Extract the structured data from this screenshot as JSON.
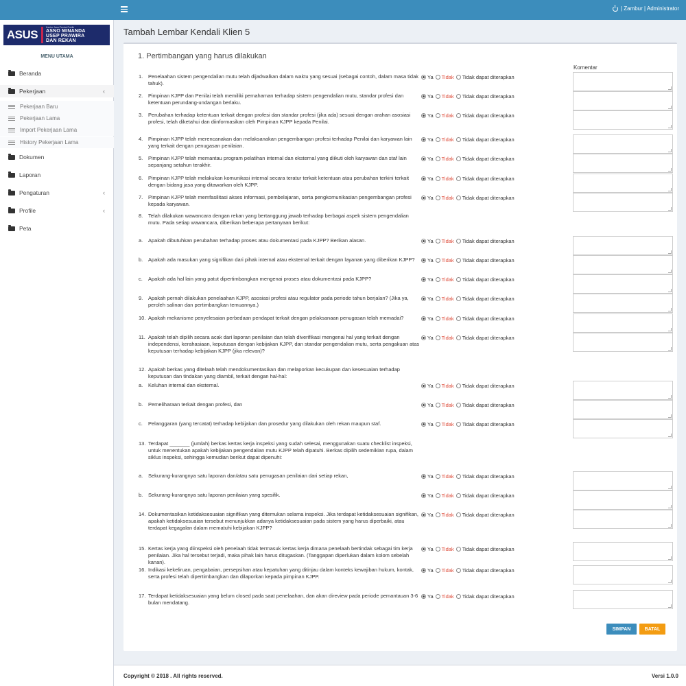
{
  "header": {
    "user_text": "| Zambur | Administrator"
  },
  "logo": {
    "brand": "ASUS",
    "small_text": "Kantor Jasa Pendai Publik",
    "name_line1": "ASNO MINANDA",
    "name_line2": "USEP PRAWIRA",
    "name_line3": "DAN REKAN"
  },
  "sidebar": {
    "header": "MENU UTAMA",
    "items": [
      {
        "label": "Beranda"
      },
      {
        "label": "Pekerjaan"
      },
      {
        "label": "Dokumen"
      },
      {
        "label": "Laporan"
      },
      {
        "label": "Pengaturan"
      },
      {
        "label": "Profile"
      },
      {
        "label": "Peta"
      }
    ],
    "subitems": [
      {
        "label": "Pekerjaan Baru"
      },
      {
        "label": "Pekerjaan Lama"
      },
      {
        "label": "Import Pekerjaan Lama"
      },
      {
        "label": "History Pekerjaan Lama"
      }
    ]
  },
  "page": {
    "title": "Tambah Lembar Kendali Klien 5",
    "section_title": "1. Pertimbangan yang harus dilakukan",
    "komentar_label": "Komentar"
  },
  "options": {
    "ya": "Ya",
    "tidak": "Tidak",
    "tidak_dapat": "Tidak dapat diterapkan"
  },
  "questions": [
    {
      "num": "1.",
      "text": "Penelaahan sistem pengendalian mutu telah dijadwalkan dalam waktu yang sesuai (sebagai contoh, dalam masa tidak tahuk)."
    },
    {
      "num": "2.",
      "text": "Pimpinan KJPP dan Penilai telah memiliki pemahaman terhadap sistem pengendalian mutu, standar profesi dan ketentuan perundang-undangan berlaku."
    },
    {
      "num": "3.",
      "text": "Perubahan terhadap ketentuan terkait dengan profesi dan standar profesi (jika ada) sesuai dengan arahan asosiasi profesi, telah diketahui dan diinformasikan oleh Pimpinan KJPP kepada Penilai."
    },
    {
      "num": "4.",
      "text": "Pimpinan KJPP telah merencanakan dan melaksanakan pengembangan profesi terhadap Penilai dan karyawan lain yang terkait dengan penugasan penilaian."
    },
    {
      "num": "5.",
      "text": "Pimpinan KJPP telah memantau program pelatihan internal dan eksternal yang diikuti oleh karyawan dan staf lain sepanjang setahun terakhir."
    },
    {
      "num": "6.",
      "text": "Pimpinan KJPP telah melakukan komunikasi internal secara teratur terkait ketentuan atau perubahan terkini terkait dengan bidang jasa yang ditawarkan oleh KJPP."
    },
    {
      "num": "7.",
      "text": "Pimpinan KJPP telah memfasilitasi akses informasi, pembelajaran, serta pengkomunikasian pengembangan profesi kepada karyawan."
    },
    {
      "num": "8.",
      "text": "Telah dilakukan wawancara dengan rekan yang bertanggung jawab terhadap berbagai aspek sistem pengendalian mutu. Pada setiap wawancara, diberikan beberapa pertanyaan berikut:"
    },
    {
      "num": "a.",
      "text": "Apakah dibutuhkan perubahan terhadap proses atau dokumentasi pada KJPP? Berikan alasan."
    },
    {
      "num": "b.",
      "text": "Apakah ada masukan yang signifikan dari pihak internal atau eksternal terkait dengan layanan yang diberikan KJPP?"
    },
    {
      "num": "c.",
      "text": "Apakah ada hal lain yang patut dipertimbangkan mengenai proses atau dokumentasi pada KJPP?"
    },
    {
      "num": "9.",
      "text": "Apakah pernah dilakukan penelaahan KJPP, asosiasi profesi atau regulator pada periode tahun berjalan? (Jika ya, peroleh salinan dan pertimbangkan temuannya.)"
    },
    {
      "num": "10.",
      "text": "Apakah mekanisme penyelesaian perbedaan pendapat terkait dengan pelaksanaan penugasan telah memadai?"
    },
    {
      "num": "11.",
      "text": "Apakah telah dipilih secara acak dari laporan penilaian dan telah diverifikasi mengenai hal yang terkait dengan independensi, kerahasiaan, keputusan dengan kebijakan KJPP, dan standar pengendalian mutu, serta pengakuan atas keputusan terhadap kebijakan KJPP (jika relevan)?"
    },
    {
      "num": "12.",
      "text": "Apakah berkas yang ditelaah telah mendokumentasikan dan melaporkan kecukupan dan kesesuaian terhadap keputusan dan tindakan yang diambil, terkait dengan hal-hal:"
    },
    {
      "num": "a.",
      "text": "Keluhan internal dan eksternal."
    },
    {
      "num": "b.",
      "text": "Pemeliharaan terkait dengan profesi, dan"
    },
    {
      "num": "c.",
      "text": "Pelanggaran (yang tercatat) terhadap kebijakan dan prosedur yang dilakukan oleh rekan maupun staf."
    },
    {
      "num": "13.",
      "text": "Terdapat _______ (jumlah) berkas kertas kerja inspeksi yang sudah selesai, menggunakan suatu checklist inspeksi, untuk menentukan apakah kebijakan pengendalian mutu KJPP telah dipatuhi. Berkas dipilih sedemikian rupa, dalam siklus inspeksi, sehingga kemudian berikut dapat dipenuhi:"
    },
    {
      "num": "a.",
      "text": "Sekurang-kurangnya satu laporan dan/atau satu penugasan penilaian dari setiap rekan,"
    },
    {
      "num": "b.",
      "text": "Sekurang-kurangnya satu laporan penilaian yang spesifik."
    },
    {
      "num": "14.",
      "text": "Dokumentasikan ketidaksesuaian signifikan yang ditemukan selama inspeksi. Jika terdapat ketidaksesuaian signifikan, apakah ketidaksesuaian tersebut menunjukkan adanya ketidaksesuaian pada sistem yang harus diperbaiki, atau terdapat kegagalan dalam mematuhi kebijakan KJPP?"
    },
    {
      "num": "15.",
      "text": "Kertas kerja yang diinspeksi oleh penelaah tidak termasuk kertas kerja dimana penelaah bertindak sebagai tim kerja penilaian. Jika hal tersebut terjadi, maka pihak lain harus ditugaskan. (Tanggapan diperlukan dalam kolom sebelah kanan)."
    },
    {
      "num": "16.",
      "text": "Indikasi kekeliruan, pengabaian, persepsihan atau kepatuhan yang ditinjau dalam konteks kewajiban hukum, kontak, serta profesi telah dipertimbangkan dan dilaporkan kepada pimpinan KJPP."
    },
    {
      "num": "17.",
      "text": "Terdapat ketidaksesuaian yang belum closed pada saat penelaahan, dan akan direview pada periode pemantauan 3-6 bulan mendatang."
    }
  ],
  "buttons": {
    "save": "SIMPAN",
    "cancel": "BATAL"
  },
  "footer": {
    "copyright": "Copyright © 2018 . All rights reserved.",
    "version": "Versi 1.0.0"
  },
  "colors": {
    "topbar": "#3c8dbc",
    "save": "#3c8dbc",
    "cancel": "#f39c12",
    "tidak": "#dd4b39"
  }
}
